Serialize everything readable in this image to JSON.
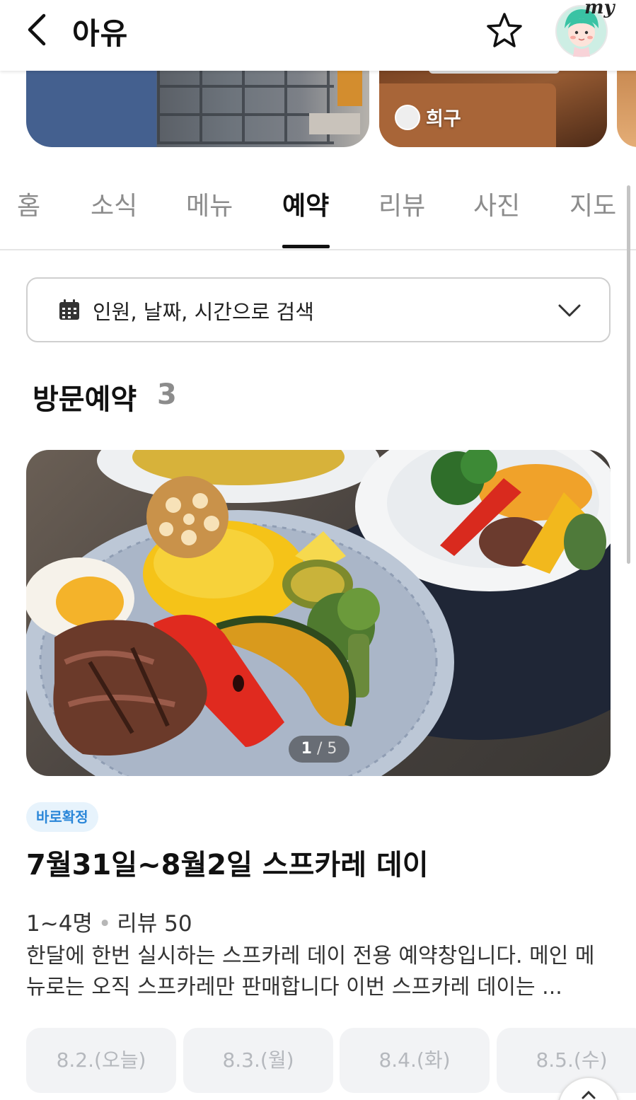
{
  "header": {
    "title": "아유",
    "back_icon": "back-arrow-icon",
    "favorite_icon": "star-icon",
    "my_label": "my"
  },
  "photos": {
    "credit_name": "희구"
  },
  "tabs": [
    {
      "label": "홈",
      "active": false
    },
    {
      "label": "소식",
      "active": false
    },
    {
      "label": "메뉴",
      "active": false
    },
    {
      "label": "예약",
      "active": true
    },
    {
      "label": "리뷰",
      "active": false
    },
    {
      "label": "사진",
      "active": false
    },
    {
      "label": "지도",
      "active": false
    }
  ],
  "search": {
    "icon": "calendar-icon",
    "label": "인원, 날짜, 시간으로 검색"
  },
  "section": {
    "title": "방문예약",
    "count": "3"
  },
  "listing": {
    "photo_page_current": "1",
    "photo_page_separator": "/",
    "photo_page_total": "5",
    "badge": "바로확정",
    "title": "7월31일~8월2일 스프카레 데이",
    "party": "1~4명",
    "dot": "•",
    "reviews": "리뷰 50",
    "description": "한달에 한번 실시하는 스프카레 데이 전용 예약창입니다. 메인 메뉴로는 오직 스프카레만 판매합니다 이번 스프카레 데이는 ...",
    "dates": [
      "8.2.(오늘)",
      "8.3.(월)",
      "8.4.(화)",
      "8.5.(수)"
    ]
  },
  "colors": {
    "badge_text": "#2a86d8",
    "badge_bg": "#e7f3fc",
    "inactive_tab": "#8c8c8c",
    "chip_bg": "#f2f3f5"
  }
}
